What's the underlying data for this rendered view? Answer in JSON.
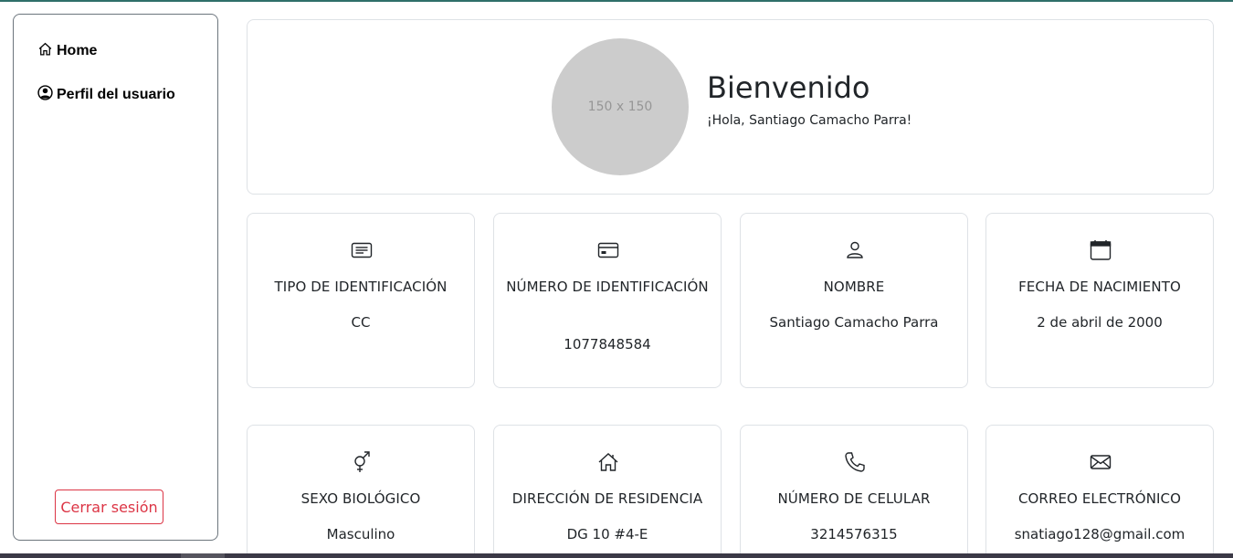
{
  "sidebar": {
    "items": [
      {
        "label": "Home",
        "icon": "home-icon"
      },
      {
        "label": "Perfil del usuario",
        "icon": "user-circle-icon"
      }
    ],
    "logout_label": "Cerrar sesión"
  },
  "welcome": {
    "avatar_placeholder": "150 x 150",
    "title": "Bienvenido",
    "greeting": "¡Hola, Santiago Camacho Parra!"
  },
  "cards": [
    {
      "label": "TIPO DE IDENTIFICACIÓN",
      "value": "CC",
      "icon": "document-text-icon"
    },
    {
      "label": "NÚMERO DE IDENTIFICACIÓN",
      "value": "1077848584",
      "icon": "credit-card-icon"
    },
    {
      "label": "NOMBRE",
      "value": "Santiago Camacho Parra",
      "icon": "person-icon"
    },
    {
      "label": "FECHA DE NACIMIENTO",
      "value": "2 de abril de 2000",
      "icon": "calendar-icon"
    },
    {
      "label": "SEXO BIOLÓGICO",
      "value": "Masculino",
      "icon": "gender-ambiguous-icon"
    },
    {
      "label": "DIRECCIÓN DE RESIDENCIA",
      "value": "DG 10 #4-E",
      "icon": "house-icon"
    },
    {
      "label": "NÚMERO DE CELULAR",
      "value": "3214576315",
      "icon": "phone-icon"
    },
    {
      "label": "CORREO ELECTRÓNICO",
      "value": "snatiago128@gmail.com",
      "icon": "envelope-icon"
    }
  ],
  "colors": {
    "danger": "#dc3545",
    "avatar_bg": "#cccccc",
    "card_border": "#dee2e6",
    "sidebar_border": "#6c757d"
  }
}
